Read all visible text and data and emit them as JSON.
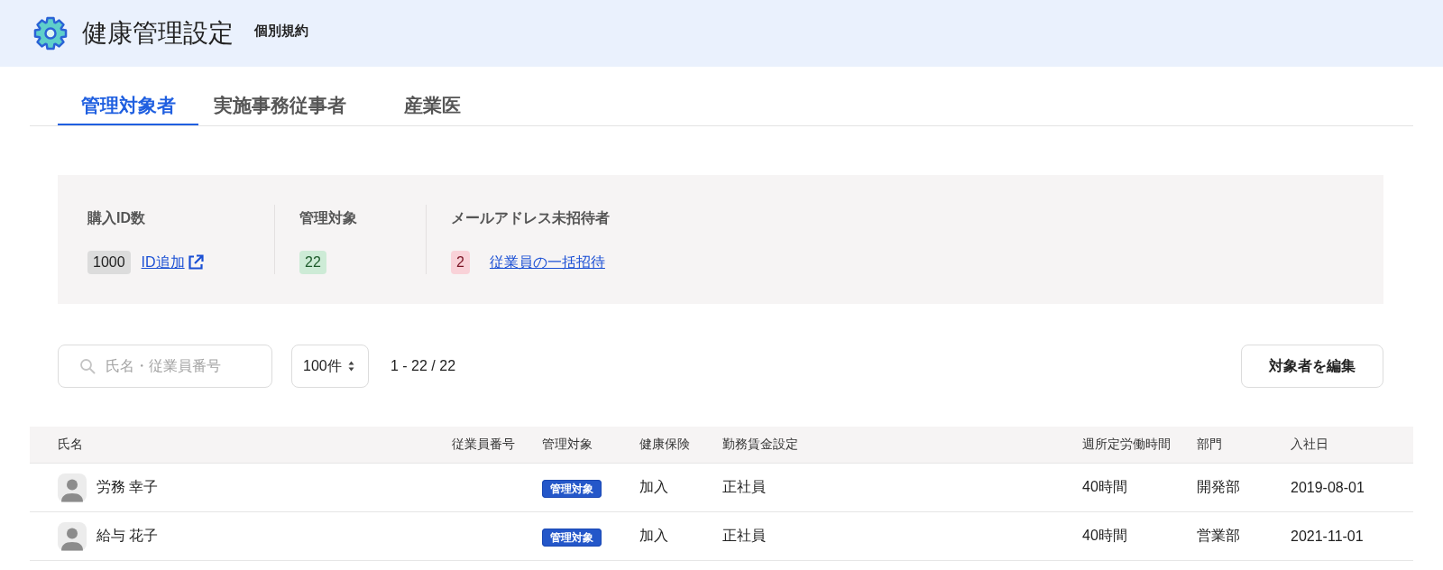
{
  "header": {
    "title": "健康管理設定",
    "subtitle": "個別規約"
  },
  "tabs": [
    {
      "label": "管理対象者",
      "selected": true
    },
    {
      "label": "実施事務従事者",
      "selected": false
    },
    {
      "label": "産業医",
      "selected": false
    }
  ],
  "summary": [
    {
      "kind": "neutral",
      "label": "購入ID数",
      "count": "1000",
      "link": {
        "label": "ID追加",
        "external": true
      }
    },
    {
      "kind": "positive",
      "label": "管理対象",
      "count": "22"
    },
    {
      "kind": "alert",
      "label": "メールアドレス未招待者",
      "count": "2",
      "link": {
        "label": "従業員の一括招待",
        "external": false
      }
    }
  ],
  "toolbar": {
    "search": {
      "placeholder": "氏名・従業員番号"
    },
    "page_size": "100件",
    "range": "1 - 22 / 22",
    "edit_button": "対象者を編集"
  },
  "table": {
    "columns": [
      "氏名",
      "従業員番号",
      "管理対象",
      "健康保険",
      "勤務賃金設定",
      "週所定労働時間",
      "部門",
      "入社日"
    ],
    "rows": [
      {
        "name": "労務 幸子",
        "managed": "管理対象",
        "health_insurance": "加入",
        "wage_setting": "正社員",
        "weekly_hours": "40時間",
        "department": "開発部",
        "joined": "2019-08-01"
      },
      {
        "name": "給与 花子",
        "managed": "管理対象",
        "health_insurance": "加入",
        "wage_setting": "正社員",
        "weekly_hours": "40時間",
        "department": "営業部",
        "joined": "2021-11-01"
      }
    ]
  }
}
